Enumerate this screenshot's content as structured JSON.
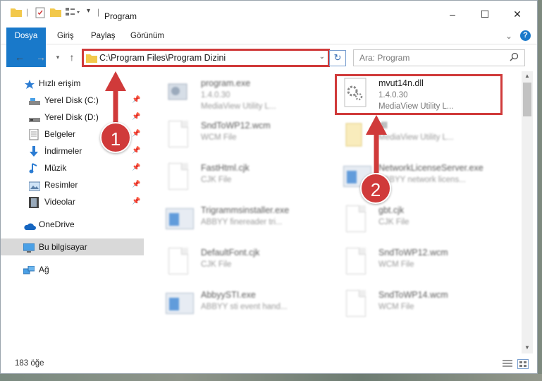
{
  "window": {
    "title": "Program",
    "controls": [
      "–",
      "☐",
      "✕"
    ]
  },
  "ribbon": {
    "tabs": [
      "Dosya",
      "Giriş",
      "Paylaş",
      "Görünüm"
    ]
  },
  "nav": {
    "address": "C:\\Program Files\\Program Dizini",
    "search_placeholder": "Ara: Program"
  },
  "sidebar": {
    "quick_access": "Hızlı erişim",
    "items": [
      {
        "label": "Yerel Disk (C:)",
        "icon": "drive-icon",
        "pinned": true
      },
      {
        "label": "Yerel Disk (D:)",
        "icon": "drive-icon",
        "pinned": true
      },
      {
        "label": "Belgeler",
        "icon": "documents-icon",
        "pinned": true
      },
      {
        "label": "İndirmeler",
        "icon": "downloads-icon",
        "pinned": true
      },
      {
        "label": "Müzik",
        "icon": "music-icon",
        "pinned": true
      },
      {
        "label": "Resimler",
        "icon": "pictures-icon",
        "pinned": true
      },
      {
        "label": "Videolar",
        "icon": "videos-icon",
        "pinned": true
      }
    ],
    "onedrive": "OneDrive",
    "this_pc": "Bu bilgisayar",
    "network": "Ağ"
  },
  "files": [
    {
      "name": "program.exe",
      "line2": "1.4.0.30",
      "line3": "MediaView Utility L...",
      "icon": "exe-icon",
      "blurred": true
    },
    {
      "name": "mvut14n.dll",
      "line2": "1.4.0.30",
      "line3": "MediaView Utility L...",
      "icon": "dll-gear-icon",
      "blurred": false
    },
    {
      "name": "SndToWP12.wcm",
      "line2": "WCM File",
      "line3": "",
      "icon": "doc-icon",
      "blurred": true
    },
    {
      "name": "dll",
      "line2": "MediaView Utility L...",
      "line3": "",
      "icon": "folder-doc-icon",
      "blurred": true
    },
    {
      "name": "FastHtml.cjk",
      "line2": "CJK File",
      "line3": "",
      "icon": "doc-icon",
      "blurred": true
    },
    {
      "name": "NetworkLicenseServer.exe",
      "line2": "ABBYY network licens...",
      "line3": "",
      "icon": "app-icon",
      "blurred": true
    },
    {
      "name": "Trigrammsinstaller.exe",
      "line2": "ABBYY finereader tri...",
      "line3": "",
      "icon": "app-icon",
      "blurred": true
    },
    {
      "name": "gbt.cjk",
      "line2": "CJK File",
      "line3": "",
      "icon": "doc-icon",
      "blurred": true
    },
    {
      "name": "DefaultFont.cjk",
      "line2": "CJK File",
      "line3": "",
      "icon": "doc-icon",
      "blurred": true
    },
    {
      "name": "SndToWP12.wcm",
      "line2": "WCM File",
      "line3": "",
      "icon": "doc-icon",
      "blurred": true
    },
    {
      "name": "AbbyySTI.exe",
      "line2": "ABBYY sti event hand...",
      "line3": "",
      "icon": "app-icon",
      "blurred": true
    },
    {
      "name": "SndToWP14.wcm",
      "line2": "WCM File",
      "line3": "",
      "icon": "doc-icon",
      "blurred": true
    }
  ],
  "status": {
    "count": "183 öğe"
  },
  "annotations": {
    "step1": "1",
    "step2": "2"
  },
  "colors": {
    "accent": "#1979ca",
    "highlight": "#d03a3a"
  }
}
